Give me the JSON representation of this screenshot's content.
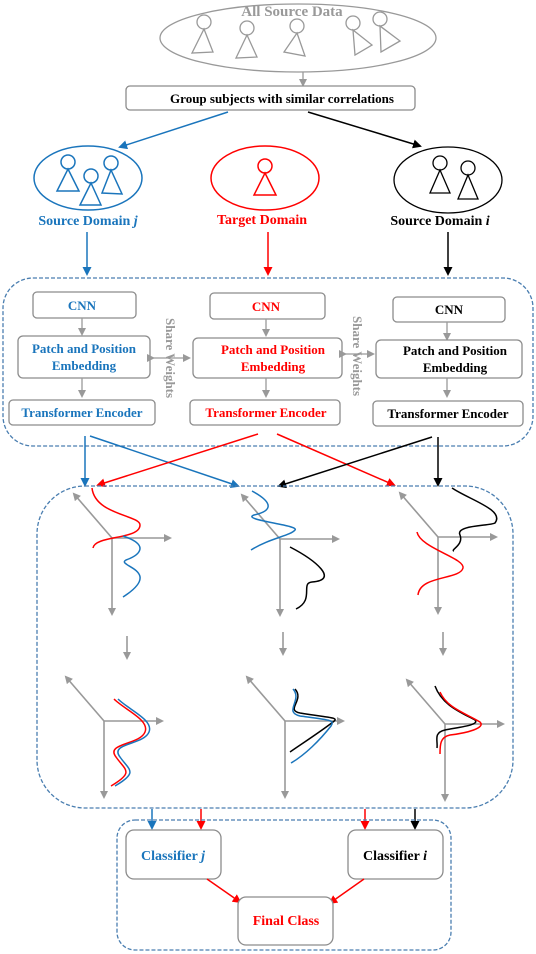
{
  "colors": {
    "blue": "#1a75bc",
    "red": "#ff0000",
    "black": "#000000",
    "gray": "#999999",
    "box_border": "#8c8c8c",
    "dashed": "#4a7eb0"
  },
  "top": {
    "all_source_data": "All Source Data",
    "group_step": "Group subjects with similar correlations"
  },
  "domains": [
    {
      "key": "source_j",
      "label_prefix": "Source Domain ",
      "label_var": "j",
      "color": "blue",
      "subjects": 3
    },
    {
      "key": "target",
      "label_prefix": "Target Domain",
      "label_var": "",
      "color": "red",
      "subjects": 1
    },
    {
      "key": "source_i",
      "label_prefix": "Source Domain ",
      "label_var": "i",
      "color": "black",
      "subjects": 2
    }
  ],
  "encoder": {
    "cnn_label": "CNN",
    "embedding_line1": "Patch and Position",
    "embedding_line2": "Embedding",
    "transformer_label": "Transformer Encoder",
    "share_weights": "Share Weights"
  },
  "alignment": {
    "description": "Feature distributions per branch before and after alignment",
    "top_row": [
      {
        "curves": [
          "red",
          "blue"
        ]
      },
      {
        "curves": [
          "blue",
          "black"
        ]
      },
      {
        "curves": [
          "red",
          "black"
        ]
      }
    ],
    "bottom_row": [
      {
        "curves": [
          "red",
          "blue"
        ]
      },
      {
        "curves": [
          "black",
          "blue"
        ]
      },
      {
        "curves": [
          "black",
          "red"
        ]
      }
    ]
  },
  "classifiers": {
    "classifier_j_prefix": "Classifier ",
    "classifier_j_var": "j",
    "classifier_i_prefix": "Classifier ",
    "classifier_i_var": "i",
    "final_class": "Final Class"
  }
}
